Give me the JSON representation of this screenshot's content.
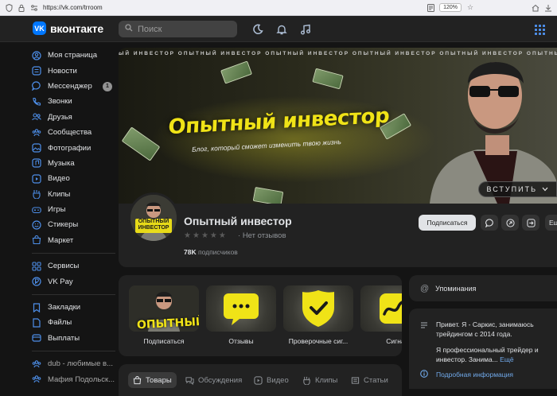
{
  "browser": {
    "url": "https://vk.com/trroom",
    "zoom": "120%"
  },
  "header": {
    "logo_text": "вконтакте",
    "search_placeholder": "Поиск"
  },
  "sidebar": {
    "items": [
      {
        "label": "Моя страница",
        "icon": "user-icon"
      },
      {
        "label": "Новости",
        "icon": "news-icon"
      },
      {
        "label": "Мессенджер",
        "icon": "message-icon",
        "badge": "1"
      },
      {
        "label": "Звонки",
        "icon": "phone-icon"
      },
      {
        "label": "Друзья",
        "icon": "friends-icon"
      },
      {
        "label": "Сообщества",
        "icon": "community-icon"
      },
      {
        "label": "Фотографии",
        "icon": "photo-icon"
      },
      {
        "label": "Музыка",
        "icon": "music-icon"
      },
      {
        "label": "Видео",
        "icon": "video-icon"
      },
      {
        "label": "Клипы",
        "icon": "clips-icon"
      },
      {
        "label": "Игры",
        "icon": "games-icon"
      },
      {
        "label": "Стикеры",
        "icon": "stickers-icon"
      },
      {
        "label": "Маркет",
        "icon": "market-icon"
      }
    ],
    "items2": [
      {
        "label": "Сервисы",
        "icon": "services-icon"
      },
      {
        "label": "VK Pay",
        "icon": "vkpay-icon"
      }
    ],
    "items3": [
      {
        "label": "Закладки",
        "icon": "bookmark-icon"
      },
      {
        "label": "Файлы",
        "icon": "files-icon"
      },
      {
        "label": "Выплаты",
        "icon": "payouts-icon"
      }
    ],
    "items4": [
      {
        "label": "dub - любимые в...",
        "icon": "group-icon"
      },
      {
        "label": "Мафия Подольск...",
        "icon": "group-icon"
      }
    ]
  },
  "cover": {
    "ticker": "ЫЙ ИНВЕСТОР   ОПЫТНЫЙ ИНВЕСТОР   ОПЫТНЫЙ ИНВЕСТОР   ОПЫТНЫЙ ИНВЕСТОР   ОПЫТНЫЙ ИНВЕСТОР   ОПЫТНЫЙ ИНВЕСТОР",
    "title": "Опытный инвестор",
    "subtitle": "Блог, который  сможет изменить твою жизнь",
    "join_label": "ВСТУПИТЬ"
  },
  "group": {
    "name": "Опытный инвестор",
    "reviews": "Нет отзывов",
    "subscribers_count": "78K",
    "subscribers_label": "подписчиков",
    "avatar_text": "ОПЫТНЫЙ ИНВЕСТОР",
    "subscribe_label": "Подписаться",
    "more_label": "Ещ"
  },
  "actions": [
    {
      "label": "Подписаться",
      "tile_text": "ОПЫТНЫЙ"
    },
    {
      "label": "Отзывы"
    },
    {
      "label": "Проверочные сиг..."
    },
    {
      "label": "Сигна"
    }
  ],
  "mentions": {
    "label": "Упоминания"
  },
  "info": {
    "line1": "Привет. Я - Саркис, занимаюсь трейдингом с 2014 года.",
    "line2": "Я профессиональный трейдер и инвестор. Занима...",
    "more_link": "Ещё",
    "details_link": "Подробная информация"
  },
  "tabs": [
    {
      "label": "Товары",
      "icon": "bag-icon",
      "active": true
    },
    {
      "label": "Обсуждения",
      "icon": "discussion-icon"
    },
    {
      "label": "Видео",
      "icon": "video-icon"
    },
    {
      "label": "Клипы",
      "icon": "clips-icon"
    },
    {
      "label": "Статьи",
      "icon": "articles-icon"
    }
  ],
  "colors": {
    "accent": "#0077ff",
    "brand_yellow": "#f0e317",
    "link": "#71aaeb",
    "background": "#141414",
    "card": "#222222"
  }
}
